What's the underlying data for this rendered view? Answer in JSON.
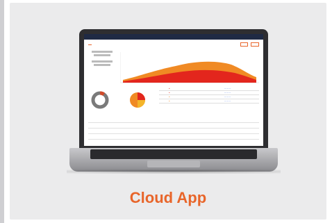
{
  "caption": "Cloud App",
  "colors": {
    "accent": "#e8652a",
    "card": "#ebebec",
    "chart_red": "#e3261d",
    "chart_orange": "#f08a24"
  }
}
